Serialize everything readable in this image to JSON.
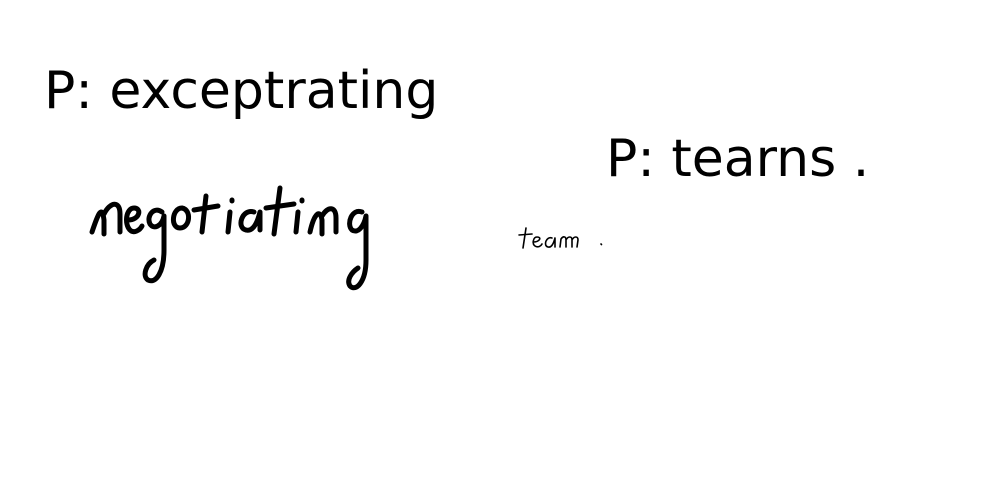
{
  "samples": [
    {
      "prediction": "P: exceptrating",
      "handwriting_text": "negotiating"
    },
    {
      "prediction": "P: tearns .",
      "handwriting_text": "team."
    }
  ]
}
